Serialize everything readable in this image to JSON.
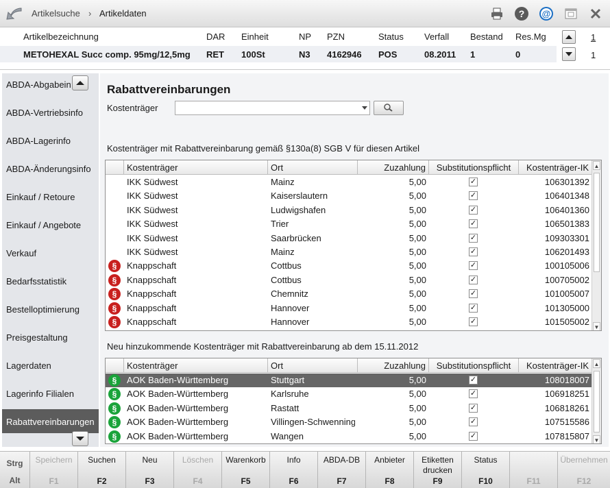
{
  "breadcrumb": {
    "parent": "Artikelsuche",
    "separator": "›",
    "current": "Artikeldaten"
  },
  "colors": {
    "selected_row": "#666666",
    "sidebar_active": "#5c5c5c",
    "discount_badge": "#c8201e",
    "new_badge": "#1aa33a"
  },
  "toolbar_icons": [
    "printer-icon",
    "help-icon",
    "email-icon",
    "window-icon",
    "close-icon"
  ],
  "article": {
    "headers": {
      "name": "Artikelbezeichnung",
      "dar": "DAR",
      "unit": "Einheit",
      "np": "NP",
      "pzn": "PZN",
      "status": "Status",
      "expiry": "Verfall",
      "stock": "Bestand",
      "reserved": "Res.Mg"
    },
    "values": {
      "name": "METOHEXAL Succ comp. 95mg/12,5mg",
      "dar": "RET",
      "unit": "100St",
      "np": "N3",
      "pzn": "4162946",
      "status": "POS",
      "expiry": "08.2011",
      "stock": "1",
      "reserved": "0"
    },
    "page_top": "1",
    "page_bottom": "1"
  },
  "sidebar": {
    "items": [
      "ABDA-Abgabeinfo",
      "ABDA-Vertriebsinfo",
      "ABDA-Lagerinfo",
      "ABDA-Änderungsinfo",
      "Einkauf / Retoure",
      "Einkauf / Angebote",
      "Verkauf",
      "Bedarfsstatistik",
      "Bestelloptimierung",
      "Preisgestaltung",
      "Lagerdaten",
      "Lagerinfo Filialen",
      "Rabattvereinbarungen"
    ],
    "active": "Rabattvereinbarungen"
  },
  "main": {
    "title": "Rabattvereinbarungen",
    "payer_label": "Kostenträger",
    "payer_value": "",
    "section1": "Kostenträger mit Rabattvereinbarung gemäß §130a(8) SGB V für diesen Artikel",
    "section2": "Neu hinzukommende Kostenträger mit Rabattvereinbarung ab dem 15.11.2012",
    "columns": [
      "Kostenträger",
      "Ort",
      "Zuzahlung",
      "Substitutionspflicht",
      "Kostenträger-IK"
    ],
    "table1": [
      {
        "badge": "",
        "payer": "IKK Südwest",
        "city": "Mainz",
        "copay": "5,00",
        "subst": "✓",
        "ik": "106301392"
      },
      {
        "badge": "",
        "payer": "IKK Südwest",
        "city": "Kaiserslautern",
        "copay": "5,00",
        "subst": "✓",
        "ik": "106401348"
      },
      {
        "badge": "",
        "payer": "IKK Südwest",
        "city": "Ludwigshafen",
        "copay": "5,00",
        "subst": "✓",
        "ik": "106401360"
      },
      {
        "badge": "",
        "payer": "IKK Südwest",
        "city": "Trier",
        "copay": "5,00",
        "subst": "✓",
        "ik": "106501383"
      },
      {
        "badge": "",
        "payer": "IKK Südwest",
        "city": "Saarbrücken",
        "copay": "5,00",
        "subst": "✓",
        "ik": "109303301"
      },
      {
        "badge": "",
        "payer": "IKK Südwest",
        "city": "Mainz",
        "copay": "5,00",
        "subst": "✓",
        "ik": "106201493"
      },
      {
        "badge": "red",
        "payer": "Knappschaft",
        "city": "Cottbus",
        "copay": "5,00",
        "subst": "✓",
        "ik": "100105006"
      },
      {
        "badge": "red",
        "payer": "Knappschaft",
        "city": "Cottbus",
        "copay": "5,00",
        "subst": "✓",
        "ik": "100705002"
      },
      {
        "badge": "red",
        "payer": "Knappschaft",
        "city": "Chemnitz",
        "copay": "5,00",
        "subst": "✓",
        "ik": "101005007"
      },
      {
        "badge": "red",
        "payer": "Knappschaft",
        "city": "Hannover",
        "copay": "5,00",
        "subst": "✓",
        "ik": "101305000"
      },
      {
        "badge": "red",
        "payer": "Knappschaft",
        "city": "Hannover",
        "copay": "5,00",
        "subst": "✓",
        "ik": "101505002"
      }
    ],
    "table2": [
      {
        "badge": "green",
        "payer": "AOK Baden-Württemberg",
        "city": "Stuttgart",
        "copay": "5,00",
        "subst": "✓",
        "ik": "108018007",
        "selected": true
      },
      {
        "badge": "green",
        "payer": "AOK Baden-Württemberg",
        "city": "Karlsruhe",
        "copay": "5,00",
        "subst": "✓",
        "ik": "106918251"
      },
      {
        "badge": "green",
        "payer": "AOK Baden-Württemberg",
        "city": "Rastatt",
        "copay": "5,00",
        "subst": "✓",
        "ik": "106818261"
      },
      {
        "badge": "green",
        "payer": "AOK Baden-Württemberg",
        "city": "Villingen-Schwenninge",
        "copay": "5,00",
        "subst": "✓",
        "ik": "107515586"
      },
      {
        "badge": "green",
        "payer": "AOK Baden-Württemberg",
        "city": "Wangen",
        "copay": "5,00",
        "subst": "✓",
        "ik": "107815807"
      }
    ],
    "badge_glyph": "§"
  },
  "fkeys": {
    "modifiers": [
      "Strg",
      "Alt"
    ],
    "keys": [
      {
        "label": "Speichern",
        "key": "F1",
        "enabled": false
      },
      {
        "label": "Suchen",
        "key": "F2",
        "enabled": true
      },
      {
        "label": "Neu",
        "key": "F3",
        "enabled": true
      },
      {
        "label": "Löschen",
        "key": "F4",
        "enabled": false
      },
      {
        "label": "Warenkorb",
        "key": "F5",
        "enabled": true
      },
      {
        "label": "Info",
        "key": "F6",
        "enabled": true
      },
      {
        "label": "ABDA-DB",
        "key": "F7",
        "enabled": true
      },
      {
        "label": "Anbieter",
        "key": "F8",
        "enabled": true
      },
      {
        "label": "Etiketten drucken",
        "key": "F9",
        "enabled": true
      },
      {
        "label": "Status",
        "key": "F10",
        "enabled": true
      },
      {
        "label": "",
        "key": "F11",
        "enabled": false
      },
      {
        "label": "Übernehmen",
        "key": "F12",
        "enabled": false
      }
    ]
  }
}
